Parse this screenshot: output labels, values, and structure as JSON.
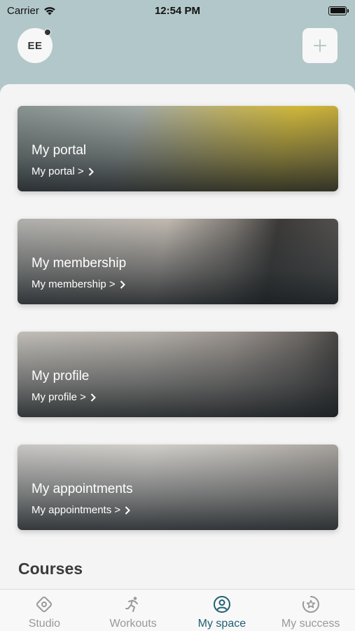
{
  "status_bar": {
    "carrier": "Carrier",
    "time": "12:54 PM"
  },
  "header": {
    "avatar_initials": "EE",
    "add_icon": "plus-icon"
  },
  "cards": [
    {
      "title": "My portal",
      "link": "My portal >"
    },
    {
      "title": "My membership",
      "link": "My membership >"
    },
    {
      "title": "My profile",
      "link": "My profile >"
    },
    {
      "title": "My appointments",
      "link": "My appointments >"
    }
  ],
  "sections": {
    "courses_title": "Courses"
  },
  "tab_bar": {
    "tabs": [
      {
        "label": "Studio",
        "icon": "studio-icon"
      },
      {
        "label": "Workouts",
        "icon": "running-figure-icon"
      },
      {
        "label": "My space",
        "icon": "user-circle-icon",
        "active": true
      },
      {
        "label": "My success",
        "icon": "star-badge-icon"
      }
    ],
    "active_color": "#1f5f72",
    "inactive_color": "#999999"
  },
  "colors": {
    "header_bg": "#b2c7c9",
    "sheet_bg": "#f4f4f4"
  }
}
